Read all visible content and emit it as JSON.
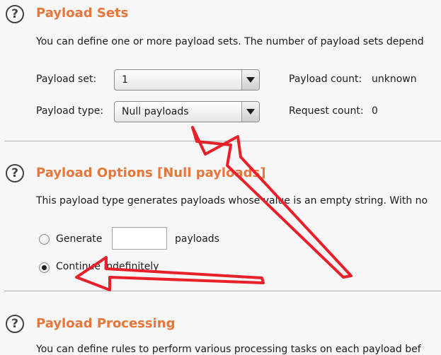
{
  "payload_sets": {
    "title": "Payload Sets",
    "description": "You can define one or more payload sets. The number of payload sets depend",
    "set_label": "Payload set:",
    "set_value": "1",
    "type_label": "Payload type:",
    "type_value": "Null payloads",
    "payload_count_label": "Payload count:",
    "payload_count_value": "unknown",
    "request_count_label": "Request count:",
    "request_count_value": "0"
  },
  "payload_options": {
    "title": "Payload Options [Null payloads]",
    "description": "This payload type generates payloads whose value is an empty string. With no",
    "generate_label": "Generate",
    "generate_value": "",
    "payloads_suffix": "payloads",
    "continue_label": "Continue indefinitely",
    "selected_option": "continue_indefinitely"
  },
  "payload_processing": {
    "title": "Payload Processing",
    "description": "You can define rules to perform various processing tasks on each payload bef"
  },
  "colors": {
    "section_title": "#e8763a",
    "annotation_arrow": "#e8202a"
  },
  "icons": {
    "help": "help-circle-icon",
    "dropdown": "chevron-down-icon"
  }
}
